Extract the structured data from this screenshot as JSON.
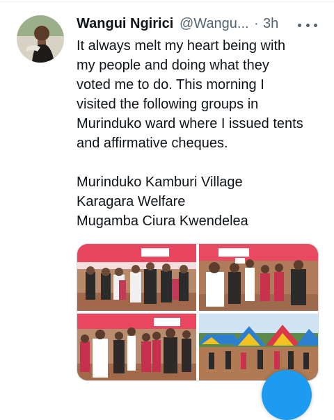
{
  "tweet": {
    "author_name": "Wangui Ngirici",
    "handle": "@Wangu...",
    "separator": "·",
    "time": "3h",
    "text_lines": [
      "It always melt my heart being with",
      "my people and doing what they",
      "voted me to do. This morning I",
      "visited the following groups in",
      "Murinduko ward where I issued tents",
      "and affirmative cheques."
    ],
    "groups": [
      "Murinduko Kamburi Village",
      "Karagara Welfare",
      "Mugamba Ciura Kwendelea"
    ]
  },
  "icons": {
    "more": "more-options-icon",
    "compose": "compose-tweet-icon"
  },
  "colors": {
    "text": "#0f1419",
    "secondary": "#536471",
    "accent": "#1d9bf0",
    "tent_red": "#d9374a",
    "tent_blue": "#2f7fd1",
    "tent_yellow": "#f3c321"
  },
  "media": {
    "photo_count": 4
  }
}
